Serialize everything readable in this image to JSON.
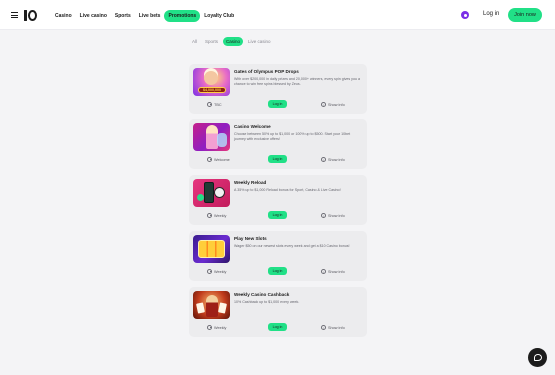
{
  "header": {
    "nav": [
      "Casino",
      "Live casino",
      "Sports",
      "Live bets",
      "Promotions",
      "Loyalty Club"
    ],
    "active_nav": "Promotions",
    "login_label": "Log in",
    "join_label": "Join now"
  },
  "filters": {
    "items": [
      "All",
      "Sports",
      "Casino",
      "Live casino"
    ],
    "active": "Casino"
  },
  "promotions": [
    {
      "title": "Gates of Olympus POP Drops",
      "description": "With over $200,000 in daily prizes and 20,000+ winners, every spin gives you a chance to win free spins blessed by Zeus.",
      "meta": "TBC",
      "image_text": "$4,000,000",
      "button_label": "Log in",
      "info_label": "Show info"
    },
    {
      "title": "Casino Welcome",
      "description": "Choose between 50% up to $1,000 or 100% up to $500. Start your 10bet journey with exclusive offers!",
      "meta": "Welcome",
      "button_label": "Log in",
      "info_label": "Show info"
    },
    {
      "title": "Weekly Reload",
      "description": "A 35% up to $1,000 Reload bonus for Sport, Casino & Live Casino!",
      "meta": "Weekly",
      "button_label": "Log in",
      "info_label": "Show info"
    },
    {
      "title": "Play New Slots",
      "description": "Wager $50 on our newest slots every week and get a $10 Casino bonus!",
      "meta": "Weekly",
      "button_label": "Log in",
      "info_label": "Show info"
    },
    {
      "title": "Weekly Casino Cashback",
      "description": "10% Cashback up to $1,000 every week.",
      "meta": "Weekly",
      "button_label": "Log in",
      "info_label": "Show info"
    }
  ],
  "colors": {
    "accent": "#21e087",
    "user_icon": "#7b2fe6",
    "text": "#1c1c1c"
  },
  "icons": [
    "menu-icon",
    "logo",
    "user-icon",
    "clock-icon",
    "info-icon",
    "chat-icon"
  ]
}
